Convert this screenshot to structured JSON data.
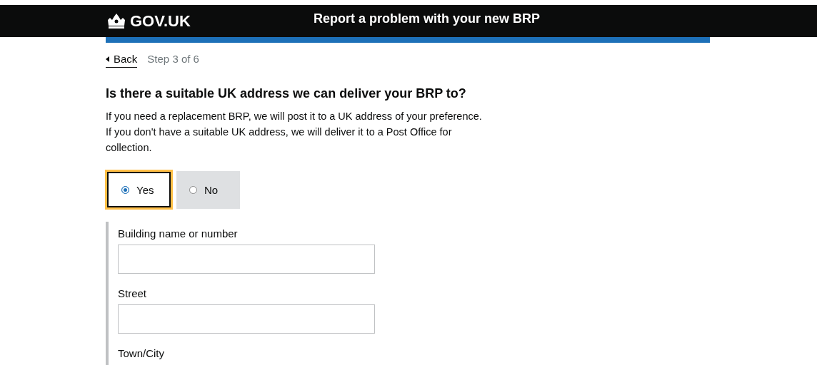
{
  "header": {
    "logo": "GOV.UK",
    "service_title": "Report a problem with your new BRP"
  },
  "back_link": "Back",
  "step": "Step 3 of 6",
  "question": "Is there a suitable UK address we can deliver your BRP to?",
  "hint": "If you need a replacement BRP, we will post it to a UK address of your preference. If you don't have a suitable UK address, we will deliver it to a Post Office for collection.",
  "options": [
    {
      "label": "Yes",
      "selected": true
    },
    {
      "label": "No",
      "selected": false
    }
  ],
  "address_fields": [
    {
      "label": "Building name or number",
      "kind": "input"
    },
    {
      "label": "Street",
      "kind": "input"
    },
    {
      "label": "Town/City",
      "kind": "label"
    }
  ]
}
